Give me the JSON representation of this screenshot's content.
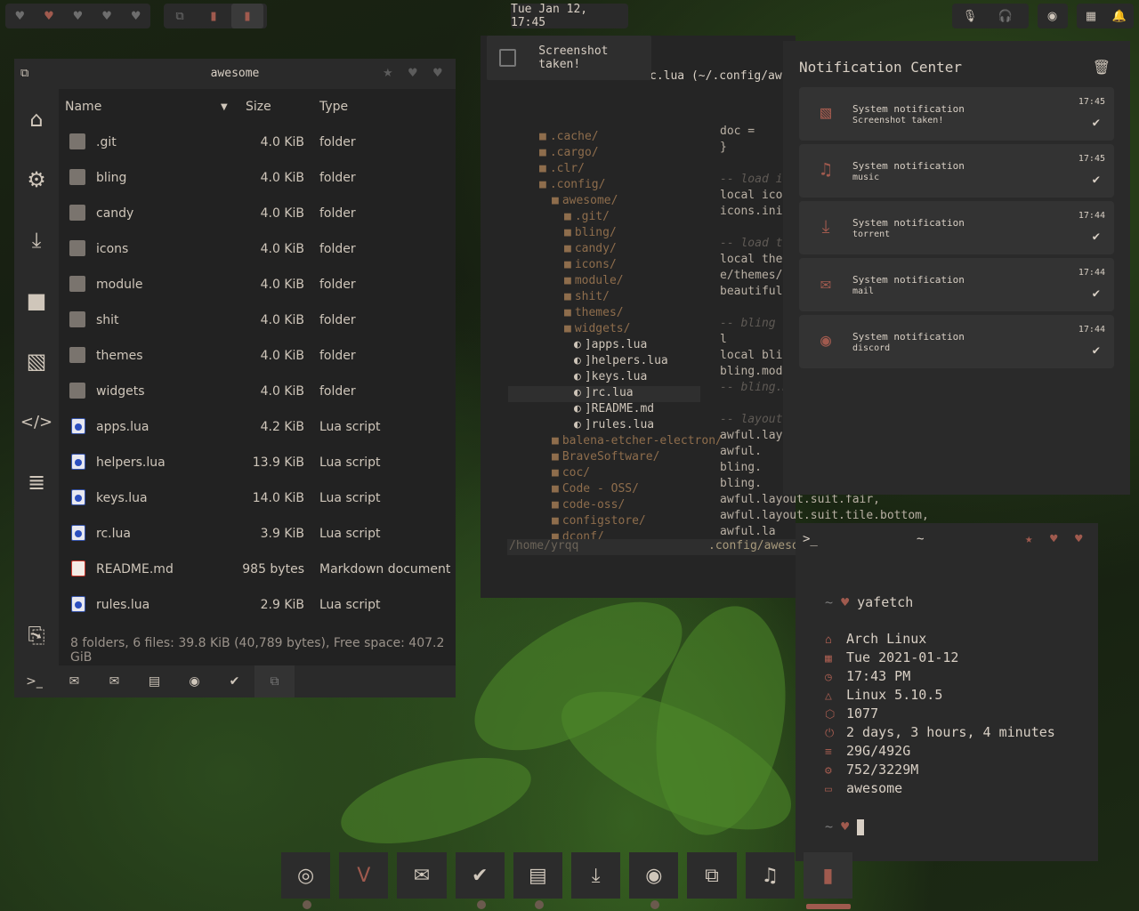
{
  "topbar": {
    "left_icons": [
      "heart-icon",
      "heart-icon",
      "heart-icon",
      "heart-icon",
      "heart-icon"
    ],
    "app_icons": [
      "copy-icon",
      "terminal-icon",
      "terminal-icon"
    ],
    "clock": "Tue Jan 12, 17:45",
    "right_icons": [
      "microphone-icon",
      "headphones-icon",
      "discord-icon",
      "grid-icon",
      "bell-icon"
    ]
  },
  "file_manager": {
    "title": "awesome",
    "columns": {
      "name": "Name",
      "size": "Size",
      "type": "Type"
    },
    "rows": [
      {
        "name": ".git",
        "size": "4.0 KiB",
        "type": "folder",
        "kind": "folder"
      },
      {
        "name": "bling",
        "size": "4.0 KiB",
        "type": "folder",
        "kind": "folder"
      },
      {
        "name": "candy",
        "size": "4.0 KiB",
        "type": "folder",
        "kind": "folder"
      },
      {
        "name": "icons",
        "size": "4.0 KiB",
        "type": "folder",
        "kind": "folder"
      },
      {
        "name": "module",
        "size": "4.0 KiB",
        "type": "folder",
        "kind": "folder"
      },
      {
        "name": "shit",
        "size": "4.0 KiB",
        "type": "folder",
        "kind": "folder"
      },
      {
        "name": "themes",
        "size": "4.0 KiB",
        "type": "folder",
        "kind": "folder"
      },
      {
        "name": "widgets",
        "size": "4.0 KiB",
        "type": "folder",
        "kind": "folder"
      },
      {
        "name": "apps.lua",
        "size": "4.2 KiB",
        "type": "Lua script",
        "kind": "lua"
      },
      {
        "name": "helpers.lua",
        "size": "13.9 KiB",
        "type": "Lua script",
        "kind": "lua"
      },
      {
        "name": "keys.lua",
        "size": "14.0 KiB",
        "type": "Lua script",
        "kind": "lua"
      },
      {
        "name": "rc.lua",
        "size": "3.9 KiB",
        "type": "Lua script",
        "kind": "lua"
      },
      {
        "name": "README.md",
        "size": "985 bytes",
        "type": "Markdown document",
        "kind": "md"
      },
      {
        "name": "rules.lua",
        "size": "2.9 KiB",
        "type": "Lua script",
        "kind": "lua"
      }
    ],
    "status": "8 folders, 6 files: 39.8 KiB (40,789 bytes), Free space: 407.2 GiB",
    "sidebar_icons": [
      "home-icon",
      "settings-icon",
      "download-icon",
      "video-icon",
      "image-icon",
      "code-icon",
      "document-icon",
      "clipboard-icon"
    ],
    "taskbar_icons": [
      "terminal-icon",
      "mail-icon",
      "mail-icon",
      "calendar-icon",
      "discord-icon",
      "check-icon",
      "copy-icon"
    ]
  },
  "editor": {
    "title_fragment": "c.lua (~/.config/aw",
    "tree": [
      ".cache/",
      ".cargo/",
      ".clr/",
      ".config/",
      "awesome/",
      ".git/",
      "bling/",
      "candy/",
      "icons/",
      "module/",
      "shit/",
      "themes/",
      "widgets/",
      "]apps.lua",
      "]helpers.lua",
      "]keys.lua",
      "]rc.lua",
      "]README.md",
      "]rules.lua",
      "balena-etcher-electron/",
      "BraveSoftware/",
      "coc/",
      "Code - OSS/",
      "code-oss/",
      "configstore/",
      "dconf/"
    ],
    "code": [
      {
        "t": "    doc =",
        "cm": false
      },
      {
        "t": "}",
        "cm": false
      },
      {
        "t": "",
        "cm": false
      },
      {
        "t": "-- load ic",
        "cm": true
      },
      {
        "t": "local icon",
        "cm": false
      },
      {
        "t": "icons.init",
        "cm": false
      },
      {
        "t": "",
        "cm": false
      },
      {
        "t": "-- load th",
        "cm": true
      },
      {
        "t": "local them",
        "cm": false
      },
      {
        "t": "e/themes/\"",
        "cm": false
      },
      {
        "t": "beautiful.",
        "cm": false
      },
      {
        "t": "",
        "cm": false
      },
      {
        "t": "-- bling n",
        "cm": true
      },
      {
        "t": "l",
        "cm": false
      },
      {
        "t": "local blin",
        "cm": false
      },
      {
        "t": "bling.modu",
        "cm": false
      },
      {
        "t": "-- bling.m",
        "cm": true
      },
      {
        "t": "",
        "cm": false
      },
      {
        "t": "-- layouts",
        "cm": true
      },
      {
        "t": "awful.layo",
        "cm": false
      },
      {
        "t": "    awful.",
        "cm": false
      },
      {
        "t": "    bling.",
        "cm": false
      },
      {
        "t": "    bling.",
        "cm": false
      },
      {
        "t": "    awful.layout.suit.fair,",
        "cm": false
      },
      {
        "t": "    awful.layout.suit.tile.bottom,",
        "cm": false
      },
      {
        "t": "    awful.la",
        "cm": false
      }
    ],
    "status_left": "/home/yrqq",
    "status_right": ".config/awesom"
  },
  "toast": {
    "text": "Screenshot taken!"
  },
  "notification_center": {
    "title": "Notification Center",
    "items": [
      {
        "icon": "image-icon",
        "title": "System notification",
        "body": "Screenshot taken!",
        "time": "17:45"
      },
      {
        "icon": "music-icon",
        "title": "System notification",
        "body": "music",
        "time": "17:45"
      },
      {
        "icon": "download-icon",
        "title": "System notification",
        "body": "torrent",
        "time": "17:44"
      },
      {
        "icon": "mail-icon",
        "title": "System notification",
        "body": "mail",
        "time": "17:44"
      },
      {
        "icon": "discord-icon",
        "title": "System notification",
        "body": "discord",
        "time": "17:44"
      }
    ]
  },
  "fetch": {
    "prompt": ">_",
    "cwd": "~",
    "command_prompt": "~",
    "command": "yafetch",
    "lines": [
      {
        "icon": "home-icon",
        "text": "Arch Linux"
      },
      {
        "icon": "calendar-icon",
        "text": "Tue 2021-01-12"
      },
      {
        "icon": "clock-icon",
        "text": "17:43 PM"
      },
      {
        "icon": "linux-icon",
        "text": "Linux 5.10.5"
      },
      {
        "icon": "package-icon",
        "text": "1077"
      },
      {
        "icon": "power-icon",
        "text": "2 days, 3 hours, 4 minutes"
      },
      {
        "icon": "disk-icon",
        "text": "29G/492G"
      },
      {
        "icon": "memory-icon",
        "text": "752/3229M"
      },
      {
        "icon": "window-icon",
        "text": "awesome"
      }
    ],
    "next_prompt": "~"
  },
  "dock": [
    "chrome-icon",
    "vim-icon",
    "mail-icon",
    "check-icon",
    "calendar-icon",
    "download-icon",
    "discord-icon",
    "copy-icon",
    "music-icon",
    "terminal-icon"
  ],
  "colors": {
    "accent": "#a05a4e",
    "panel": "#2a2a2a",
    "text": "#d8cfc4"
  }
}
